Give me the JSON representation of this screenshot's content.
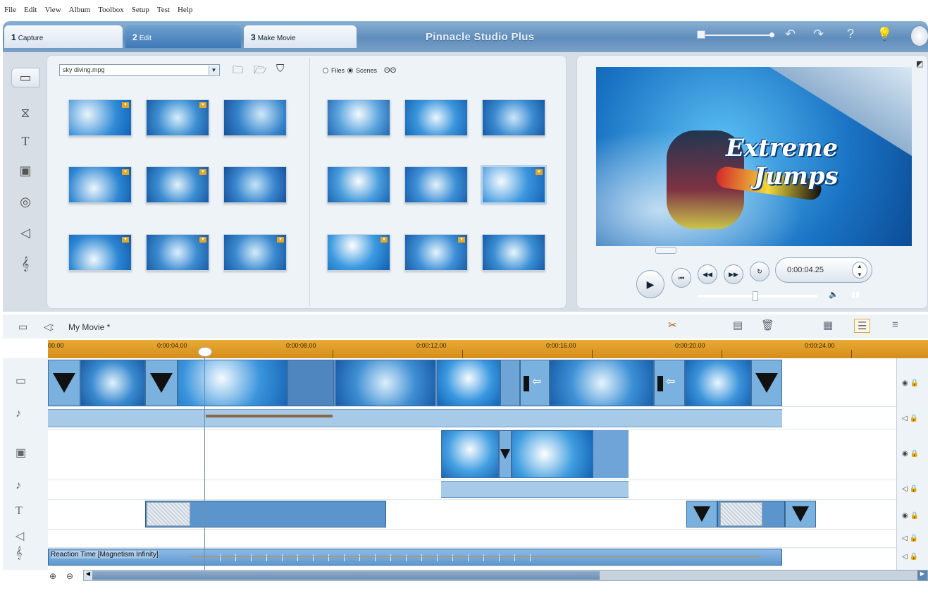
{
  "menu": [
    "File",
    "Edit",
    "View",
    "Album",
    "Toolbox",
    "Setup",
    "Test",
    "Help"
  ],
  "tabs": [
    {
      "number": "1",
      "label": "Capture"
    },
    {
      "number": "2",
      "label": "Edit"
    },
    {
      "number": "3",
      "label": "Make Movie"
    }
  ],
  "app_title": "Pinnacle Studio Plus",
  "album": {
    "file_name": "sky diving.mpg",
    "view_options": {
      "files_label": "Files",
      "scenes_label": "Scenes",
      "selected": "Scenes"
    }
  },
  "preview": {
    "overlay_line1": "Extreme",
    "overlay_line2": "Jumps",
    "timecode": "0:00:04.25"
  },
  "timeline": {
    "movie_title": "My Movie *",
    "ruler_ticks": [
      "00.00",
      "0:00:04.00",
      "0:00:08.00",
      "0:00:12.00",
      "0:00:16.00",
      "0:00:20.00",
      "0:00:24.00"
    ],
    "music_clip_label": "Reaction Time [Magnetism Infinity]"
  },
  "colors": {
    "accent_blue": "#5f8dbb",
    "ruler_orange": "#e9aa36",
    "clip_blue": "#5d92c8"
  },
  "icons": {
    "side_tools": [
      "video-album-icon",
      "transitions-icon",
      "titles-icon",
      "photos-icon",
      "disc-menus-icon",
      "sound-effects-icon",
      "music-icon"
    ],
    "top_controls": [
      "undo-icon",
      "redo-icon",
      "help-icon",
      "tips-icon",
      "globe-icon"
    ],
    "playback": [
      "play-icon",
      "go-to-start-icon",
      "rewind-icon",
      "fast-forward-icon",
      "loop-icon"
    ]
  }
}
